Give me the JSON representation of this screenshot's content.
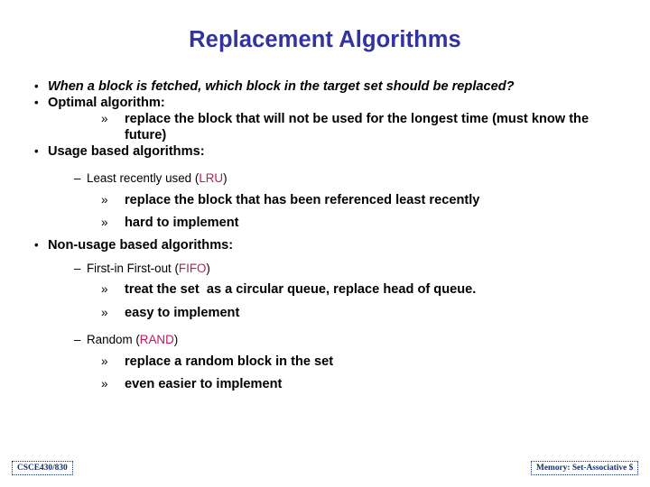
{
  "slide": {
    "title": "Replacement Algorithms",
    "title_color": "#3333A0",
    "highlight_color": "#C2185B",
    "background_color": "#FFFFFF",
    "bullets": {
      "b1_marker": "•",
      "b1_text": "When a block is fetched, which block in the target set should be replaced?",
      "b2_marker": "•",
      "b2_text": "Optimal algorithm:",
      "b3_marker": "»",
      "b3_text": "replace the block that will not be used for the longest time (must know the future)",
      "b4_marker": "•",
      "b4_text": "Usage based algorithms:",
      "b5_marker": "–",
      "b5_text_pre": "Least recently used (",
      "b5_text_hl": "LRU",
      "b5_text_post": ")",
      "b6_marker": "»",
      "b6_text": "replace the block that has been referenced least recently",
      "b7_marker": "»",
      "b7_text": "hard to implement",
      "b8_marker": "•",
      "b8_text": "Non-usage based algorithms:",
      "b9_marker": "–",
      "b9_text_pre": "First-in First-out (",
      "b9_text_hl": "FIFO",
      "b9_text_post": ")",
      "b10_marker": "»",
      "b10_text": "treat the set  as a circular queue, replace head of queue.",
      "b11_marker": "»",
      "b11_text": "easy to implement",
      "b12_marker": "–",
      "b12_text_pre": "Random (",
      "b12_text_hl": "RAND",
      "b12_text_post": ")",
      "b13_marker": "»",
      "b13_text": "replace a random block in the set",
      "b14_marker": "»",
      "b14_text": "even easier to implement"
    },
    "footer": {
      "left": "CSCE430/830",
      "right": "Memory: Set-Associative $"
    }
  }
}
